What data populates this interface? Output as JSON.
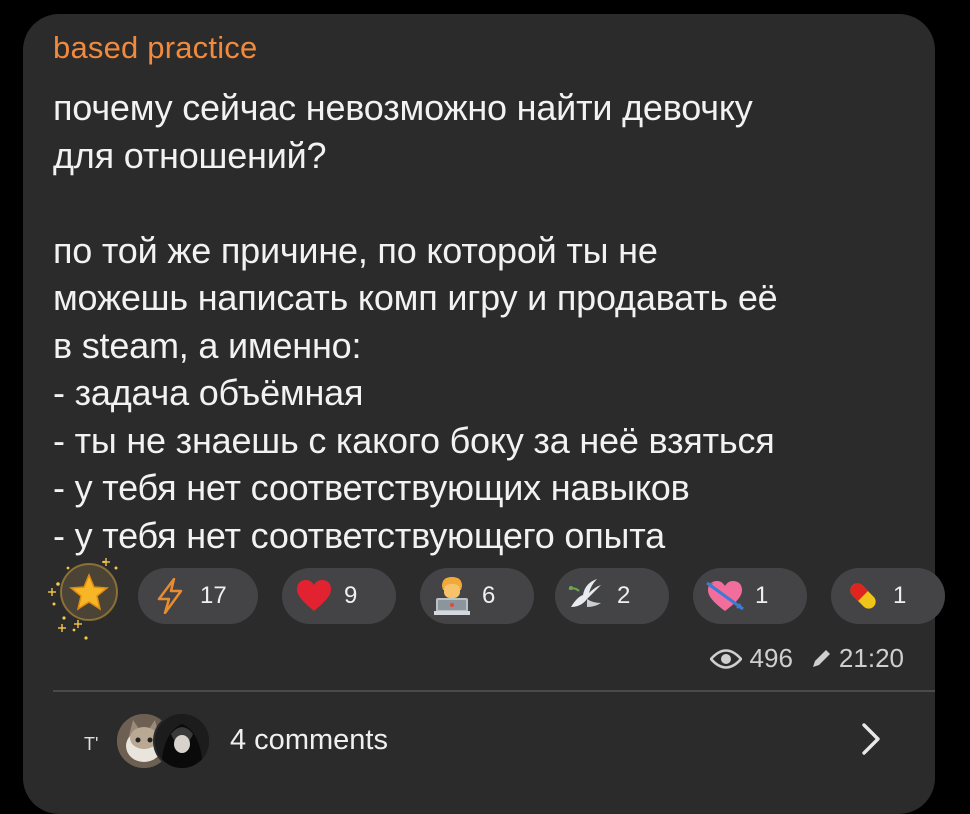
{
  "post": {
    "channel_name": "based practice",
    "lines": [
      "почему сейчас невозможно найти девочку",
      "для отношений?",
      "",
      "по той же причине, по которой ты не",
      "можешь написать комп игру и продавать её",
      "в steam, а именно:",
      "- задача объёмная",
      "- ты не знаешь с какого боку за неё взяться",
      "- у тебя нет соответствующих навыков",
      "- у тебя нет соответствующего опыта"
    ]
  },
  "reactions": [
    {
      "icon": "star-icon",
      "count": ""
    },
    {
      "icon": "lightning-icon",
      "count": "17"
    },
    {
      "icon": "heart-icon",
      "count": "9"
    },
    {
      "icon": "technologist-icon",
      "count": "6"
    },
    {
      "icon": "dove-icon",
      "count": "2"
    },
    {
      "icon": "heart-arrow-icon",
      "count": "1"
    },
    {
      "icon": "pill-icon",
      "count": "1"
    }
  ],
  "meta": {
    "views": "496",
    "time": "21:20"
  },
  "comments": {
    "badge": "T'",
    "label": "4 comments"
  },
  "colors": {
    "background": "#000000",
    "bubble": "#2b2b2c",
    "channel": "#f18a3c",
    "reaction_bg": "#444446",
    "text": "#f2f2f2"
  }
}
